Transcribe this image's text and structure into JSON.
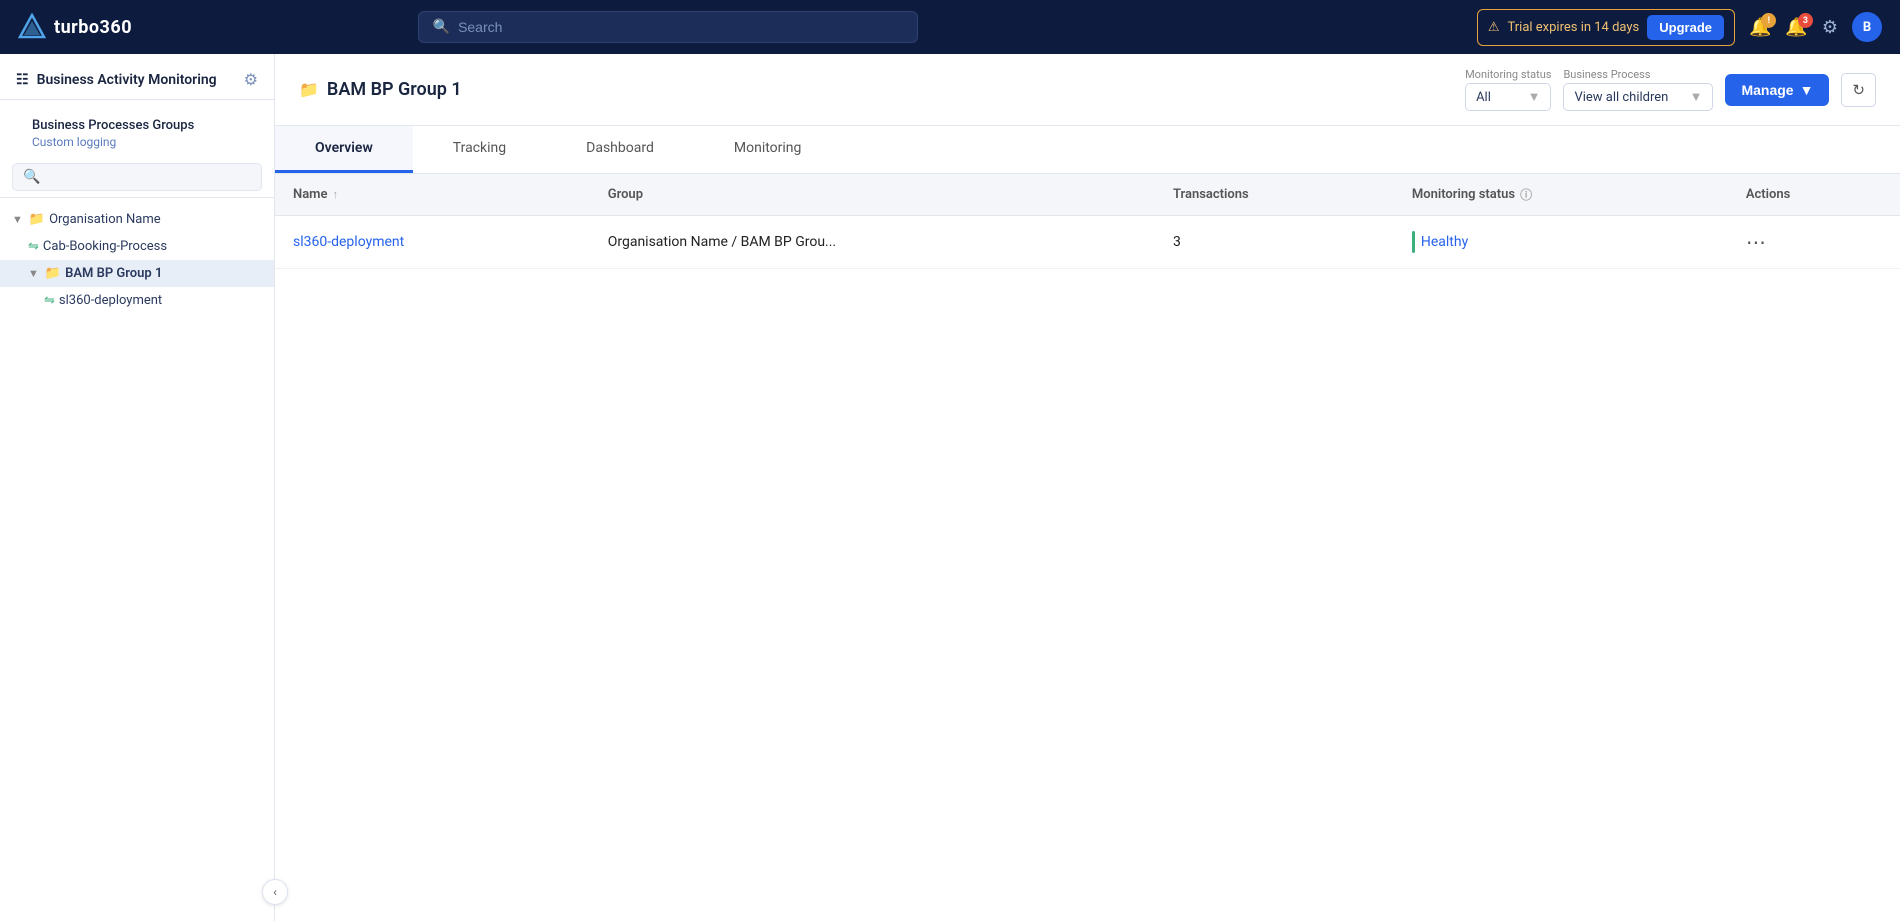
{
  "app": {
    "name": "turbo360"
  },
  "topnav": {
    "search_placeholder": "Search",
    "trial_text": "Trial expires in 14 days",
    "upgrade_label": "Upgrade",
    "notification_count": "3",
    "avatar_label": "B"
  },
  "sidebar": {
    "title": "Business Activity Monitoring",
    "section_label": "Business Processes Groups",
    "custom_logging": "Custom logging",
    "tree": [
      {
        "id": "org",
        "label": "Organisation Name",
        "type": "org",
        "indent": 0,
        "caret": true,
        "expanded": true
      },
      {
        "id": "cab",
        "label": "Cab-Booking-Process",
        "type": "process",
        "indent": 1,
        "caret": false
      },
      {
        "id": "bam",
        "label": "BAM BP Group 1",
        "type": "group",
        "indent": 1,
        "caret": true,
        "expanded": true,
        "active": true
      },
      {
        "id": "sl360",
        "label": "sl360-deployment",
        "type": "process",
        "indent": 2,
        "caret": false
      }
    ]
  },
  "header": {
    "page_title": "BAM BP Group 1",
    "monitoring_filter_label": "Monitoring status",
    "monitoring_filter_value": "All",
    "bp_filter_label": "Business Process",
    "bp_filter_value": "View all children",
    "manage_label": "Manage"
  },
  "tabs": [
    {
      "id": "overview",
      "label": "Overview",
      "active": true
    },
    {
      "id": "tracking",
      "label": "Tracking",
      "active": false
    },
    {
      "id": "dashboard",
      "label": "Dashboard",
      "active": false
    },
    {
      "id": "monitoring",
      "label": "Monitoring",
      "active": false
    }
  ],
  "table": {
    "columns": [
      {
        "id": "name",
        "label": "Name",
        "sortable": true
      },
      {
        "id": "group",
        "label": "Group",
        "sortable": false
      },
      {
        "id": "transactions",
        "label": "Transactions",
        "sortable": false
      },
      {
        "id": "monitoring_status",
        "label": "Monitoring status",
        "sortable": false,
        "info": true
      },
      {
        "id": "actions",
        "label": "Actions",
        "sortable": false
      }
    ],
    "rows": [
      {
        "name": "sl360-deployment",
        "group": "Organisation Name / BAM BP Grou...",
        "transactions": "3",
        "monitoring_status": "Healthy",
        "status_color": "#3eaf7c"
      }
    ]
  }
}
